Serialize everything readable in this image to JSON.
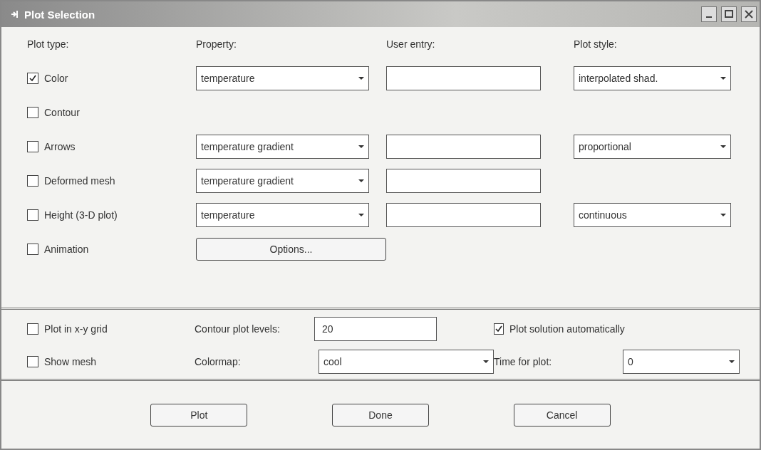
{
  "window": {
    "title": "Plot Selection"
  },
  "headers": [
    "Plot type:",
    "Property:",
    "User entry:",
    "Plot style:"
  ],
  "plot_rows": [
    {
      "kind": "fields",
      "label": "Color",
      "checked": true,
      "property": "temperature",
      "user_entry_field": true,
      "plot_style": "interpolated shad."
    },
    {
      "kind": "none",
      "label": "Contour",
      "checked": false
    },
    {
      "kind": "fields",
      "label": "Arrows",
      "checked": false,
      "property": "temperature gradient",
      "user_entry_field": true,
      "plot_style": "proportional"
    },
    {
      "kind": "fields",
      "label": "Deformed mesh",
      "checked": false,
      "property": "temperature gradient",
      "user_entry_field": true
    },
    {
      "kind": "fields",
      "label": "Height (3-D plot)",
      "checked": false,
      "property": "temperature",
      "user_entry_field": true,
      "plot_style": "continuous"
    },
    {
      "kind": "button",
      "label": "Animation",
      "checked": false,
      "button": "Options..."
    }
  ],
  "options": {
    "plot_in_xy_grid": {
      "label": "Plot in x-y grid",
      "checked": false
    },
    "show_mesh": {
      "label": "Show mesh",
      "checked": false
    },
    "contour_levels": {
      "label": "Contour plot levels:",
      "value": "20"
    },
    "colormap": {
      "label": "Colormap:",
      "value": "cool"
    },
    "plot_automatically": {
      "label": "Plot solution automatically",
      "checked": true
    },
    "time_for_plot": {
      "label": "Time for plot:",
      "value": "0"
    }
  },
  "buttons": [
    "Plot",
    "Done",
    "Cancel"
  ]
}
